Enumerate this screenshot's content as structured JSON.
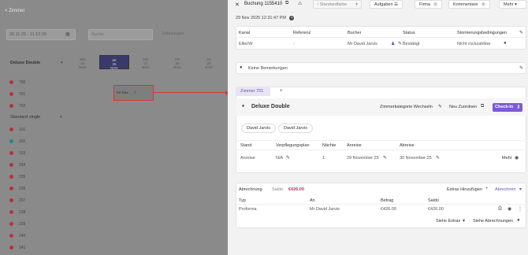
{
  "background": {
    "back_link": "< Zimmer",
    "date_range": "26.11.25 - 11.12.25",
    "search_placeholder": "Suche",
    "auswahl": "Zufuhrungen",
    "category1": "Deluxe Double",
    "category2": "Standard single",
    "days": [
      {
        "dow": "MO",
        "num": "24",
        "mon": "NOV"
      },
      {
        "dow": "MI",
        "num": "26",
        "mon": "NOV"
      },
      {
        "dow": "DO",
        "num": "27",
        "mon": "NOV"
      },
      {
        "dow": "FR",
        "num": "28",
        "mon": "NOV"
      },
      {
        "dow": "SA",
        "num": "29",
        "mon": "NOV"
      }
    ],
    "rooms_deluxe": [
      "700",
      "701",
      "702"
    ],
    "rooms_standard": [
      "101",
      "102",
      "103",
      "234",
      "235",
      "236",
      "237",
      "238",
      "239",
      "240",
      "241"
    ],
    "booking_label": "Mr Dav..."
  },
  "header": {
    "title": "Buchung 1155410",
    "color_select": "Standardfarbe",
    "aufgaben": "Aufgaben",
    "firma": "Firma",
    "firma_count": "0",
    "kommentare": "Kommentare",
    "kommentare_count": "0",
    "mehr": "Mehr"
  },
  "created": "29 Nov 2025 12:31:47 PM",
  "booking_table": {
    "headers": [
      "Kanal",
      "Referenz",
      "Bucher",
      "Status",
      "Stornierungsbedingungen"
    ],
    "row": [
      "EllenW",
      "-",
      "Mr David Jarvis",
      "Bestätigt",
      "Nicht rückzahlbar"
    ]
  },
  "remarks": "Keine Bemerkungen",
  "room": {
    "tab": "Zimmer 701",
    "add_tab": "+",
    "name": "Deluxe Double",
    "change_category": "Zimmerkategorie Wechseln",
    "reassign": "Neu Zuordnen",
    "checkin": "Check-In",
    "guests": [
      "David Jarvis",
      "David Jarvis"
    ],
    "table_headers": [
      "Stand",
      "Verpflegungsplan",
      "Nächte",
      "Anreise",
      "Abreise"
    ],
    "table_row": [
      "Anreise",
      "N/A",
      "1",
      "29 November 25",
      "30 November 25"
    ],
    "more": "Mehr"
  },
  "billing": {
    "title": "Abrechnung",
    "saldo_label": "Saldo:",
    "saldo_value": "€426.00",
    "extras_add": "Extras Hinzufügen",
    "abrechnen": "Abrechnen",
    "headers": [
      "Typ",
      "An",
      "Betrag",
      "Saldo"
    ],
    "row": [
      "Proforma",
      "Mr David Jarvis",
      "€426.00",
      "€426.00"
    ],
    "see_extras": "Siehe Extras",
    "see_billing": "Siehe Abrechnungen"
  },
  "colors": {
    "accent": "#7b5cd6",
    "saldo": "#d2285a",
    "highlight": "#dd3333"
  }
}
